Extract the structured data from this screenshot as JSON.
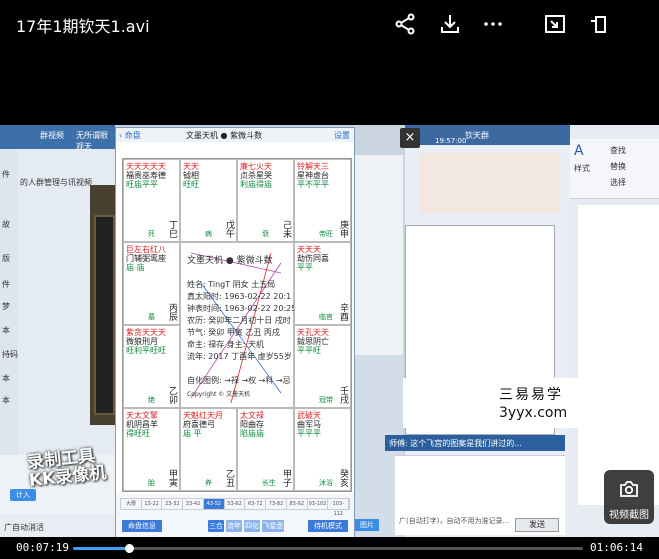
{
  "player": {
    "title": "17年1期钦天1.avi",
    "current_time": "00:07:19",
    "duration": "01:06:14",
    "progress": 0.1104,
    "screenshot_label": "视频截图"
  },
  "recording": {
    "left_window": {
      "tab_label": "群视频",
      "tab_label2": "无所谓眼观天",
      "side_items": [
        "件",
        "故",
        "版",
        "件",
        "梦",
        "本",
        "持码",
        "本",
        "本"
      ],
      "heading": "的人群管理与讯视频",
      "button_label": "计入",
      "status_text": "广自动消活"
    },
    "watermark": {
      "line1": "录制工具",
      "line2": "KK录像机"
    },
    "chart_app": {
      "back_label": "‹ 命盘",
      "title": "文墨天机 ● 紫微斗数",
      "settings_label": "设置",
      "cells": [
        {
          "stars": [
            [
              "天天天天天",
              "r"
            ],
            [
              "福贵巫寿德",
              "k"
            ],
            [
              "旺庙平平",
              "g"
            ]
          ],
          "gz": "丁巳",
          "mini": "死"
        },
        {
          "stars": [
            [
              "天天",
              "r"
            ],
            [
              "钺相",
              "k"
            ],
            [
              "旺旺",
              "g"
            ]
          ],
          "gz": "戊午",
          "mini": "病"
        },
        {
          "stars": [
            [
              "廉七火天",
              "r"
            ],
            [
              "贞杀星哭",
              "k"
            ],
            [
              "利庙得庙",
              "g"
            ]
          ],
          "gz": "己未",
          "mini": "衰"
        },
        {
          "stars": [
            [
              "铃解天三",
              "r"
            ],
            [
              "星神虚台",
              "k"
            ],
            [
              "平不平平",
              "g"
            ]
          ],
          "gz": "庚申",
          "mini": "帝旺"
        },
        {
          "stars": [
            [
              "巨左右红八",
              "r"
            ],
            [
              "门辅弼鸾座",
              "k"
            ],
            [
              "庙 庙",
              "g"
            ]
          ],
          "gz": "丙辰",
          "mini": "墓"
        },
        {
          "stars": [
            [
              "天天天",
              "r"
            ],
            [
              "劫伤同喜",
              "k"
            ],
            [
              "平平 ",
              "g"
            ]
          ],
          "gz": "辛酉",
          "mini": "临官"
        },
        {
          "stars": [
            [
              "紫贪天天天",
              "r"
            ],
            [
              "微狼刑月",
              "k"
            ],
            [
              "旺利平旺旺",
              "g"
            ]
          ],
          "gz": "乙卯",
          "mini": "绝"
        },
        {
          "stars": [
            [
              "天孔天天",
              "r"
            ],
            [
              "鉞思阴亡",
              "k"
            ],
            [
              "平平旺",
              "g"
            ]
          ],
          "gz": "壬戌",
          "mini": "冠带"
        },
        {
          "stars": [
            [
              "天太文擎",
              "r"
            ],
            [
              "机阴昌羊",
              "k"
            ],
            [
              "得旺旺",
              "g"
            ]
          ],
          "gz": "甲寅",
          "mini": "胎"
        },
        {
          "stars": [
            [
              "天魁红天月",
              "r"
            ],
            [
              "府喜德弓",
              "k"
            ],
            [
              "庙 平",
              "g"
            ]
          ],
          "gz": "乙丑",
          "mini": "养"
        },
        {
          "stars": [
            [
              "太文禄",
              "r"
            ],
            [
              "阳曲存",
              "k"
            ],
            [
              "陷庙庙",
              "g"
            ]
          ],
          "gz": "甲子",
          "mini": "长生"
        },
        {
          "stars": [
            [
              "武破天",
              "r"
            ],
            [
              "曲军马",
              "k"
            ],
            [
              "平平平",
              "g"
            ]
          ],
          "gz": "癸亥",
          "mini": "沐浴"
        }
      ],
      "center": {
        "title": "文墨天机 ● 紫微斗数",
        "name_line": "姓名: TingT    阴女 土五局",
        "solar_line": "真太阳时: 1963-02-22 20:1",
        "clock_line": "钟表时间: 1963-02-22 20:25",
        "lunar_line": "农历: 癸卯年二月初十日 戌时",
        "bazi_line": "节气: 癸卯 甲寅 乙丑 丙戌",
        "ming_line": "命主: 禄存  身主: 天机",
        "year_line": "流年: 2017 丁酉年  虚岁55岁",
        "sihua_line": "自化图例: →禄 →权 →科 →忌",
        "footer_line": "Copyright © 文墨天机"
      },
      "ticks": [
        "大限",
        "13-22",
        "23-32",
        "33-42",
        "43-52",
        "53-62",
        "63-72",
        "73-82",
        "83-92",
        "93-102",
        "103-112"
      ],
      "selected_tick": 4,
      "buttons": [
        "命盘信息",
        "三合",
        "流年",
        "四化",
        "飞星盘",
        "待机模式"
      ]
    },
    "chat": {
      "title": "钦天群",
      "time": "19:57:00",
      "message": "师傅: 这个飞宫的图案是我们讲过的...",
      "input_hint": "广(自动打字)，自动不用为准记录...",
      "send_label": "发送"
    },
    "office": {
      "ribbon_items": [
        "查找",
        "替换",
        "选择"
      ],
      "style_label": "样式"
    },
    "site": {
      "name": "三易易学",
      "url": "3yyx.com"
    }
  }
}
